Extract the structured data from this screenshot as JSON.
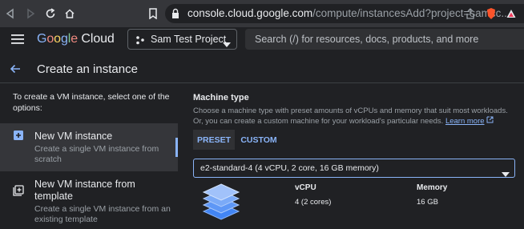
{
  "browser": {
    "url_host": "console.cloud.google.com",
    "url_path": "/compute/instancesAdd?project=samcc..."
  },
  "header": {
    "logo": "Google Cloud",
    "project": "Sam Test Project",
    "search_placeholder": "Search (/) for resources, docs, products, and more"
  },
  "page": {
    "title": "Create an instance"
  },
  "left": {
    "intro": "To create a VM instance, select one of the options:",
    "options": [
      {
        "title": "New VM instance",
        "description": "Create a single VM instance from scratch"
      },
      {
        "title": "New VM instance from template",
        "description": "Create a single VM instance from an existing template"
      }
    ]
  },
  "machine": {
    "title": "Machine type",
    "description": "Choose a machine type with preset amounts of vCPUs and memory that suit most workloads. Or, you can create a custom machine for your workload's particular needs.",
    "learn_more": "Learn more",
    "tabs": [
      "PRESET",
      "CUSTOM"
    ],
    "selected": "e2-standard-4 (4 vCPU, 2 core, 16 GB memory)",
    "vcpu_label": "vCPU",
    "vcpu_value": "4 (2 cores)",
    "memory_label": "Memory",
    "memory_value": "16 GB"
  },
  "colors": {
    "accent": "#8ab4f8",
    "background": "#202124"
  }
}
